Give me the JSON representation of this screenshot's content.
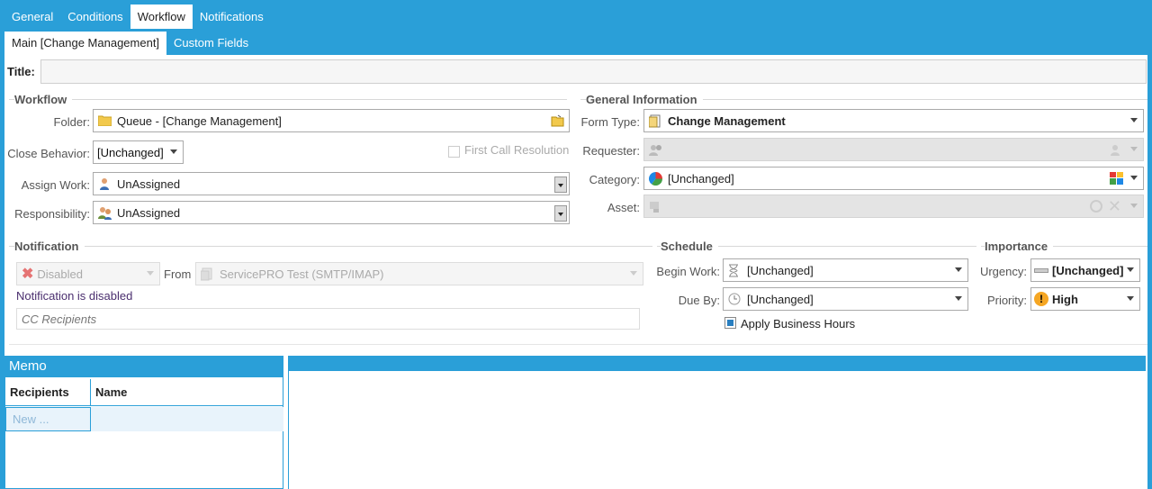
{
  "tabs": [
    "General",
    "Conditions",
    "Workflow",
    "Notifications"
  ],
  "subtabs": [
    "Main [Change Management]",
    "Custom Fields"
  ],
  "title_label": "Title:",
  "workflow": {
    "section": "Workflow",
    "folder_label": "Folder:",
    "folder_value": "Queue - [Change Management]",
    "close_label": "Close Behavior:",
    "close_value": "[Unchanged]",
    "fcr_label": "First Call Resolution",
    "assign_label": "Assign Work:",
    "assign_value": "UnAssigned",
    "resp_label": "Responsibility:",
    "resp_value": "UnAssigned"
  },
  "general": {
    "section": "General Information",
    "formtype_label": "Form Type:",
    "formtype_value": "Change Management",
    "requester_label": "Requester:",
    "category_label": "Category:",
    "category_value": "[Unchanged]",
    "asset_label": "Asset:"
  },
  "notification": {
    "section": "Notification",
    "status_value": "Disabled",
    "from_label": "From",
    "from_value": "ServicePRO Test (SMTP/IMAP)",
    "disabled_msg": "Notification is disabled",
    "cc_placeholder": "CC Recipients"
  },
  "schedule": {
    "section": "Schedule",
    "begin_label": "Begin Work:",
    "begin_value": "[Unchanged]",
    "due_label": "Due By:",
    "due_value": "[Unchanged]",
    "business_hours_label": "Apply Business Hours"
  },
  "importance": {
    "section": "Importance",
    "urgency_label": "Urgency:",
    "urgency_value": "[Unchanged]",
    "priority_label": "Priority:",
    "priority_value": "High"
  },
  "memo": {
    "title": "Memo",
    "col_recipients": "Recipients",
    "col_name": "Name",
    "new_row": "New ..."
  },
  "colors": {
    "accent": "#2a9fd8"
  }
}
